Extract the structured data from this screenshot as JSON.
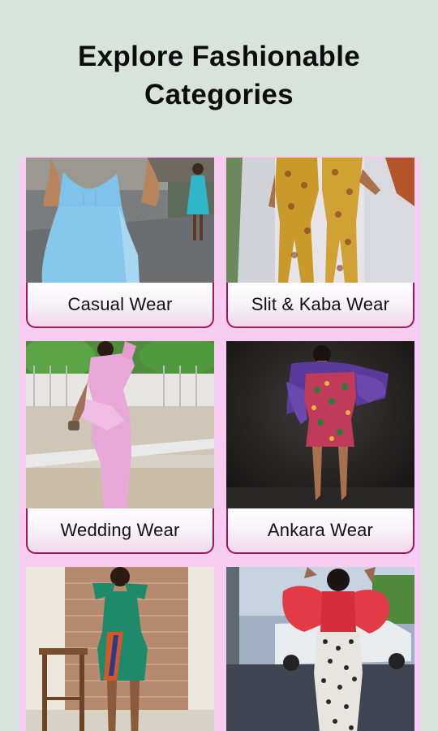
{
  "header": {
    "title_line1": "Explore Fashionable",
    "title_line2": "Categories"
  },
  "categories": [
    {
      "label": "Casual Wear"
    },
    {
      "label": "Slit & Kaba Wear"
    },
    {
      "label": "Wedding Wear"
    },
    {
      "label": "Ankara Wear"
    },
    {
      "label": "",
      "icon": "green-peplum-dress-photo"
    },
    {
      "label": "",
      "icon": "red-blouse-sequin-skirt-photo"
    }
  ],
  "colors": {
    "background": "#d8e3dd",
    "panel": "#f6cdf0",
    "card_border": "#a2174d"
  }
}
